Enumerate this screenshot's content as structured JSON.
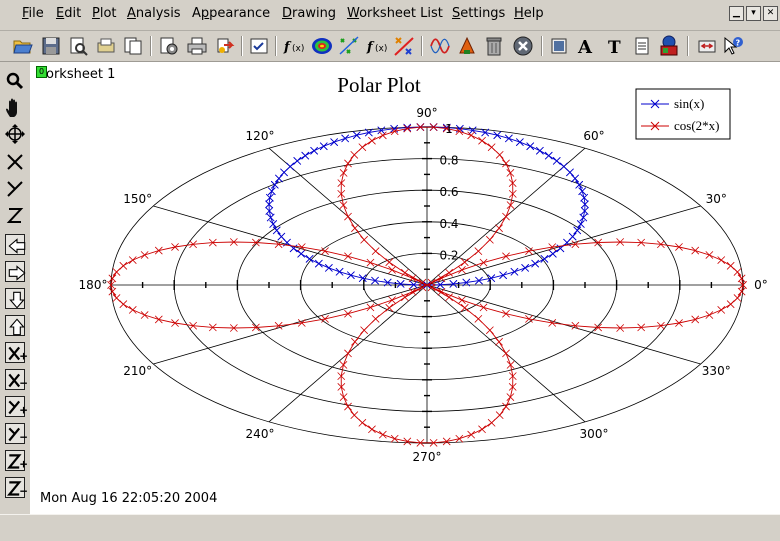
{
  "menubar": {
    "items": [
      {
        "label": "File",
        "u": "F",
        "rest": "ile"
      },
      {
        "label": "Edit",
        "u": "E",
        "rest": "dit"
      },
      {
        "label": "Plot",
        "u": "P",
        "rest": "lot"
      },
      {
        "label": "Analysis",
        "u": "A",
        "rest": "nalysis"
      },
      {
        "label": "Appearance",
        "u": "A",
        "rest": "ppearance"
      },
      {
        "label": "Drawing",
        "u": "D",
        "rest": "rawing"
      },
      {
        "label": "Worksheet List",
        "u": "W",
        "rest": "orksheet List"
      },
      {
        "label": "Settings",
        "u": "S",
        "rest": "ettings"
      },
      {
        "label": "Help",
        "u": "H",
        "rest": "elp"
      }
    ]
  },
  "worksheet": {
    "flag": "0",
    "label": "orksheet 1"
  },
  "datestamp": "Mon Aug 16 22:05:20 2004",
  "chart_data": {
    "type": "line",
    "coordinate_system": "polar",
    "title": "Polar Plot",
    "angle_ticks": [
      "0°",
      "30°",
      "60°",
      "90°",
      "120°",
      "150°",
      "180°",
      "210°",
      "240°",
      "270°",
      "300°",
      "330°"
    ],
    "radius_ticks": [
      "0.2",
      "0.4",
      "0.6",
      "0.8",
      "1"
    ],
    "radius_range": [
      0,
      1
    ],
    "grid": true,
    "legend_position": "top-right",
    "series": [
      {
        "name": "sin(x)",
        "function": "r = sin(theta)",
        "marker": "x",
        "color": "#0000cc",
        "theta_range_deg": [
          0,
          360
        ],
        "points": 150
      },
      {
        "name": "cos(2*x)",
        "function": "r = cos(2*theta)",
        "marker": "x",
        "color": "#cc0000",
        "theta_range_deg": [
          0,
          360
        ],
        "points": 150
      }
    ]
  }
}
